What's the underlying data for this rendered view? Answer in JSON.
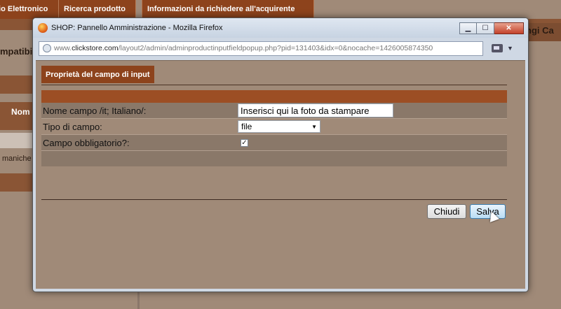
{
  "background": {
    "tabs": [
      "lio Elettronico",
      "Ricerca prodotto",
      "Informazioni da richiedere all'acquirente"
    ],
    "left_label": "mpatibile",
    "right_label": "ngi Ca",
    "column_header": "Nom",
    "row_text": "maniche"
  },
  "window": {
    "title": "SHOP: Pannello Amministrazione - Mozilla Firefox",
    "url_prefix": "www.",
    "url_domain": "clickstore.com",
    "url_path": "/layout2/admin/adminproductinputfieldpopup.php?pid=131403&idx=0&nocache=1426005874350",
    "tab_label": "Proprietà del campo di input",
    "fields": {
      "name_label": "Nome campo /it; Italiano/:",
      "name_value": "Inserisci qui la foto da stampare",
      "type_label": "Tipo di campo:",
      "type_value": "file",
      "required_label": "Campo obbligatorio?:",
      "required_checked": true
    },
    "buttons": {
      "close_label": "Chiudi",
      "save_label": "Salva"
    }
  }
}
